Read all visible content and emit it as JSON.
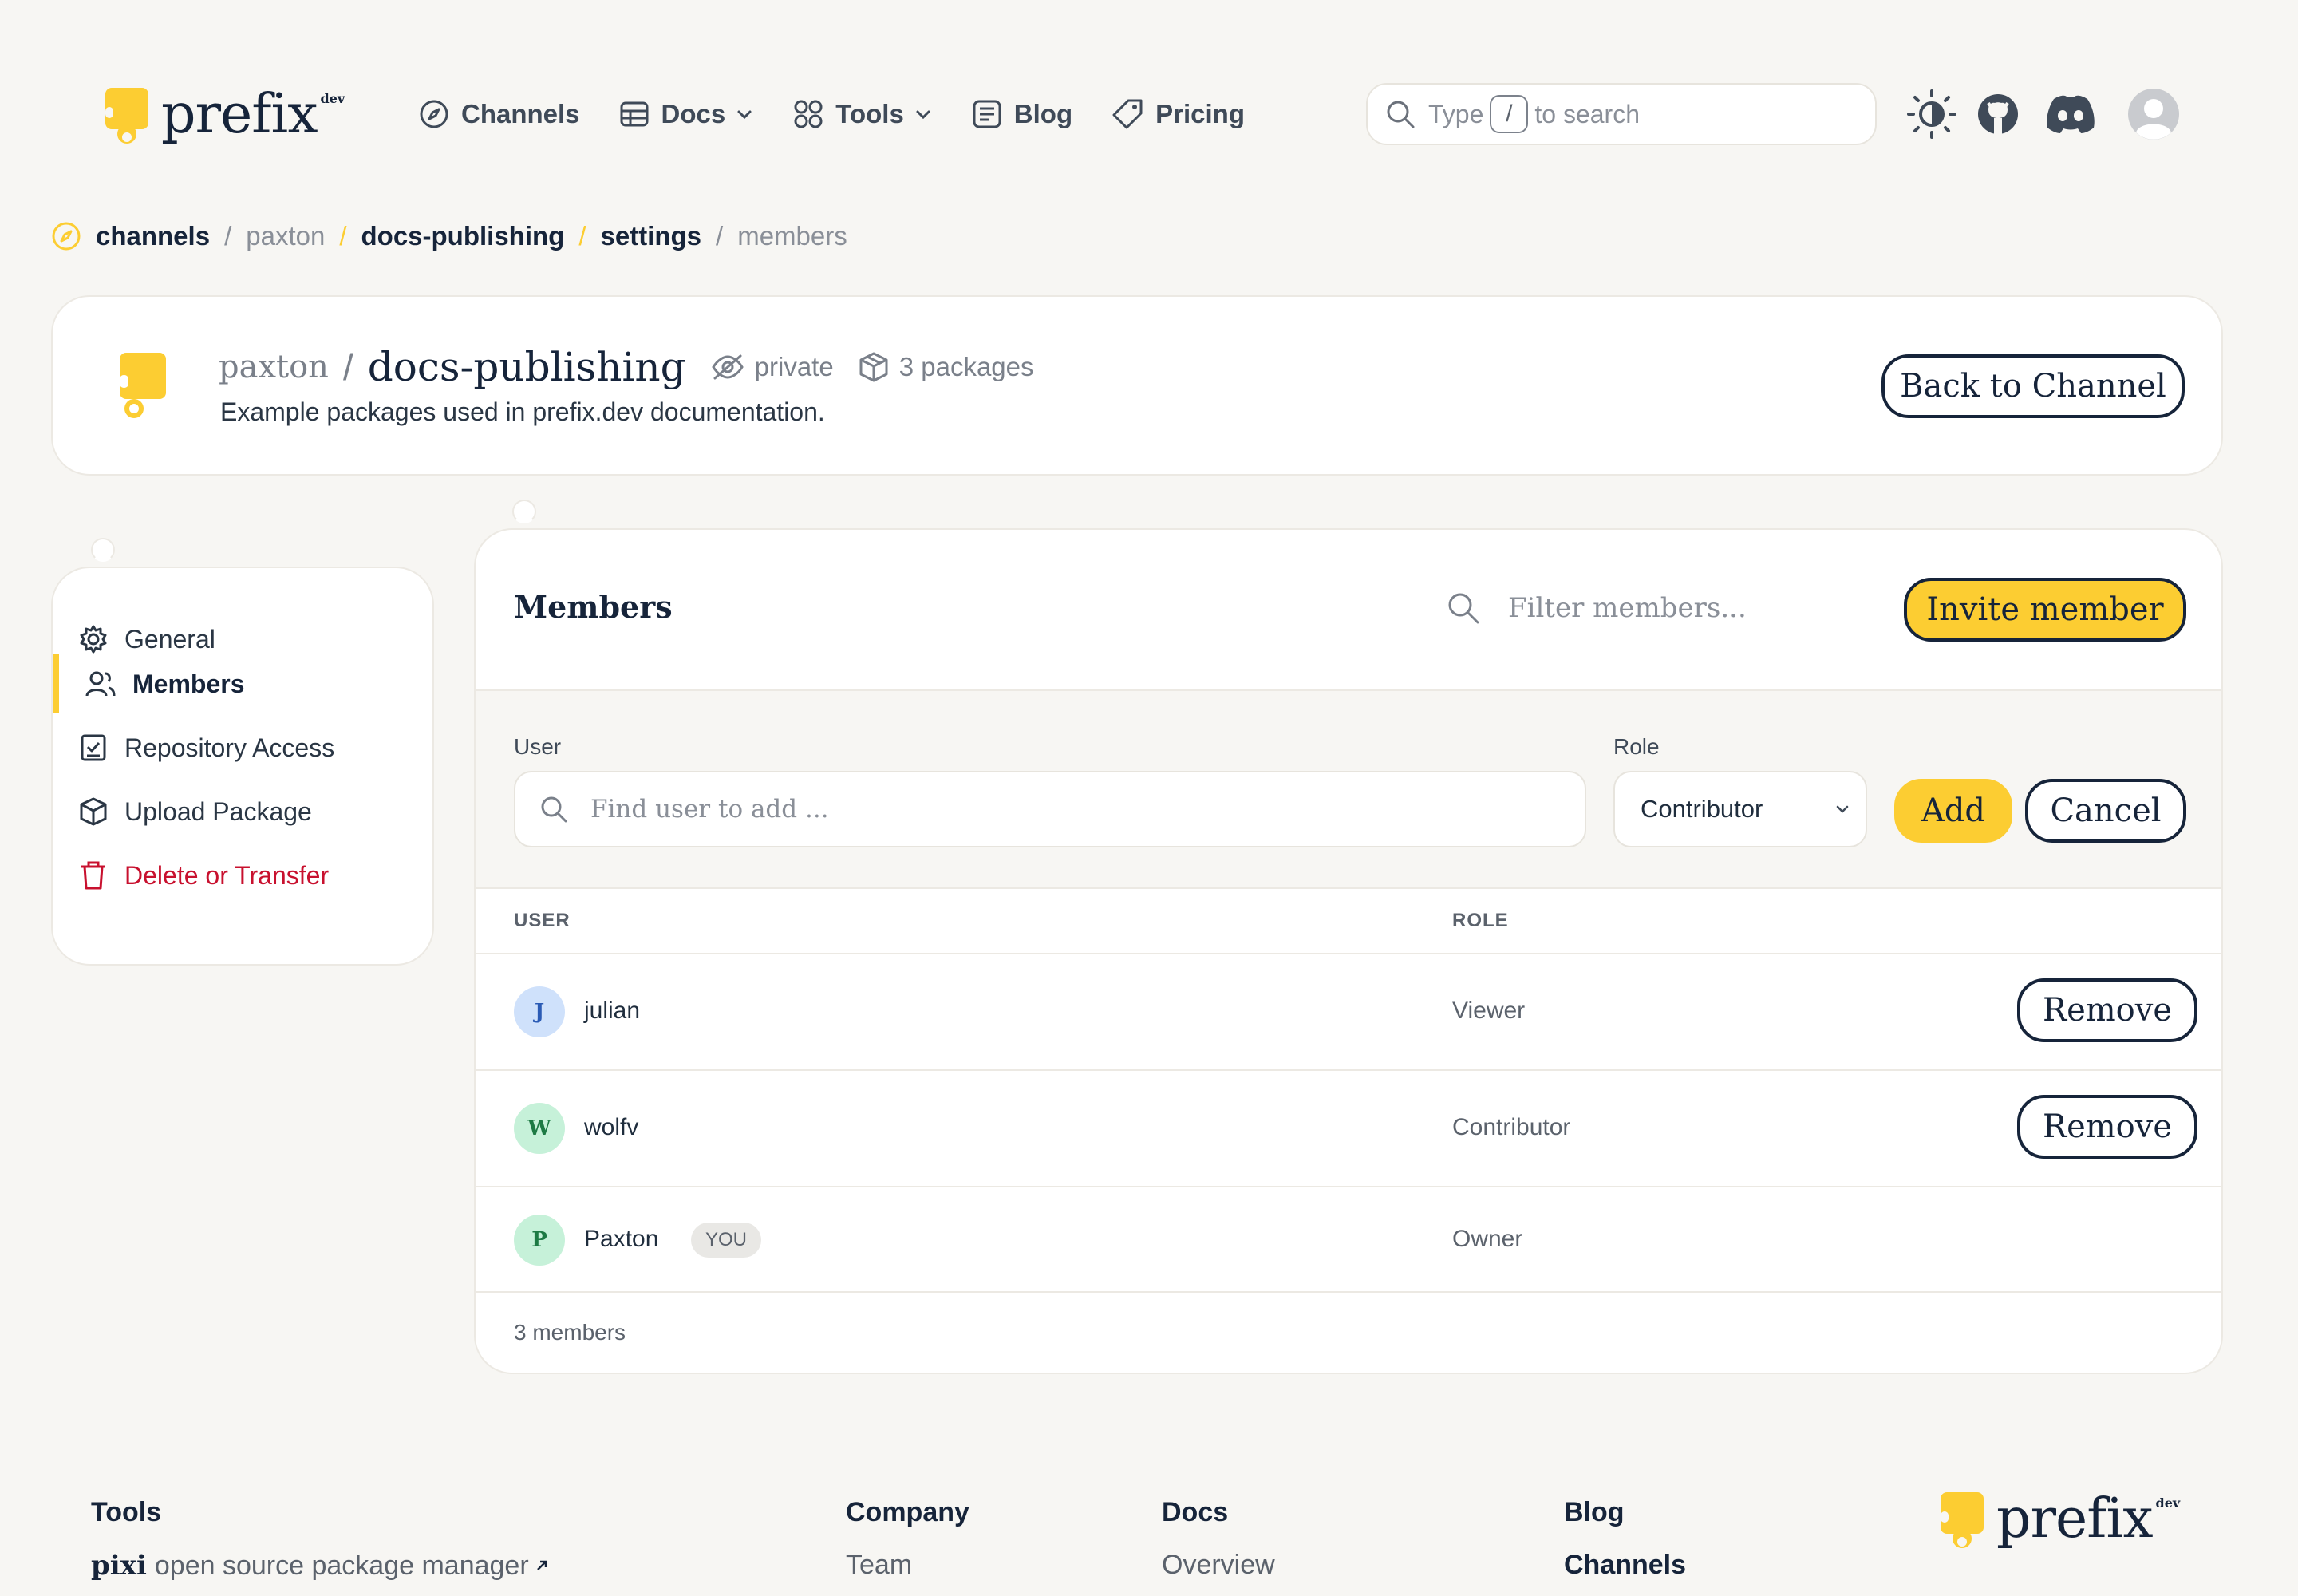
{
  "header": {
    "brand": "prefix",
    "brand_suffix": "dev",
    "nav": [
      {
        "label": "Channels",
        "icon": "compass-icon"
      },
      {
        "label": "Docs",
        "icon": "book-icon",
        "has_dropdown": true
      },
      {
        "label": "Tools",
        "icon": "grid-icon",
        "has_dropdown": true
      },
      {
        "label": "Blog",
        "icon": "newspaper-icon"
      },
      {
        "label": "Pricing",
        "icon": "tag-icon"
      }
    ],
    "search": {
      "prefix": "Type",
      "key": "/",
      "suffix": "to search"
    },
    "icons": [
      "theme-toggle-icon",
      "github-icon",
      "discord-icon",
      "user-avatar-icon"
    ]
  },
  "breadcrumb": [
    "channels",
    "paxton",
    "docs-publishing",
    "settings",
    "members"
  ],
  "channel": {
    "owner": "paxton",
    "name": "docs-publishing",
    "visibility": "private",
    "packages": "3 packages",
    "description": "Example packages used in prefix.dev documentation.",
    "back_label": "Back to Channel"
  },
  "sidebar": {
    "items": [
      {
        "label": "General",
        "icon": "gear-icon"
      },
      {
        "label": "Members",
        "icon": "users-icon",
        "active": true
      },
      {
        "label": "Repository Access",
        "icon": "checklist-icon"
      },
      {
        "label": "Upload Package",
        "icon": "package-icon"
      },
      {
        "label": "Delete or Transfer",
        "icon": "trash-icon",
        "danger": true
      }
    ]
  },
  "members_panel": {
    "title": "Members",
    "filter_placeholder": "Filter members...",
    "invite_label": "Invite member",
    "add_form": {
      "user_label": "User",
      "user_placeholder": "Find user to add ...",
      "role_label": "Role",
      "role_value": "Contributor",
      "add_label": "Add",
      "cancel_label": "Cancel"
    },
    "columns": [
      "USER",
      "ROLE"
    ],
    "rows": [
      {
        "initial": "J",
        "name": "julian",
        "role": "Viewer",
        "action": "Remove"
      },
      {
        "initial": "W",
        "name": "wolfv",
        "role": "Contributor",
        "action": "Remove"
      },
      {
        "initial": "P",
        "name": "Paxton",
        "badge": "YOU",
        "role": "Owner"
      }
    ],
    "count_label": "3 members"
  },
  "footer": {
    "columns": [
      {
        "heading": "Tools",
        "link_strong": "pixi",
        "link": "open source package manager"
      },
      {
        "heading": "Company",
        "link": "Team"
      },
      {
        "heading": "Docs",
        "link": "Overview"
      },
      {
        "heading": "Blog",
        "link": "Channels"
      }
    ],
    "brand": "prefix",
    "brand_suffix": "dev"
  },
  "colors": {
    "accent": "#fccd32",
    "ink": "#16243a",
    "danger": "#c8102e",
    "background": "#f7f6f3"
  }
}
